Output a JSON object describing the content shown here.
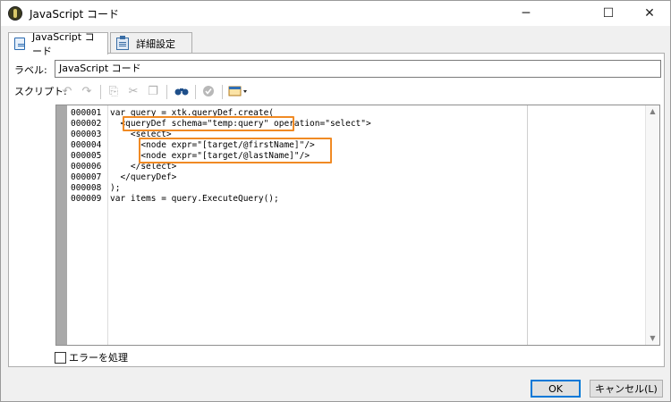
{
  "window": {
    "title": "JavaScript コード",
    "icon": "app-logo-icon"
  },
  "tabs": [
    {
      "label": "JavaScript コード",
      "icon": "script-doc-icon",
      "active": true
    },
    {
      "label": "詳細設定",
      "icon": "clipboard-icon",
      "active": false
    }
  ],
  "form": {
    "label_caption": "ラベル:",
    "label_value": "JavaScript コード",
    "script_caption": "スクリプト:"
  },
  "toolbar": [
    {
      "icon": "undo-icon",
      "enabled": false
    },
    {
      "icon": "redo-icon",
      "enabled": false
    },
    {
      "icon": "copy-icon",
      "enabled": false
    },
    {
      "icon": "cut-icon",
      "enabled": false
    },
    {
      "icon": "paste-icon",
      "enabled": false
    },
    {
      "icon": "find-binoculars-icon",
      "enabled": true
    },
    {
      "icon": "check-syntax-icon",
      "enabled": false
    },
    {
      "icon": "insert-dropdown-icon",
      "enabled": true
    }
  ],
  "code": {
    "line_numbers": [
      "000001",
      "000002",
      "000003",
      "000004",
      "000005",
      "000006",
      "000007",
      "000008",
      "000009"
    ],
    "lines": [
      "var query = xtk.queryDef.create(",
      "  <queryDef schema=\"temp:query\" operation=\"select\">",
      "    <select>",
      "      <node expr=\"[target/@firstName]\"/>",
      "      <node expr=\"[target/@lastName]\"/>",
      "    </select>",
      "  </queryDef>",
      ");",
      "var items = query.ExecuteQuery();"
    ]
  },
  "options": {
    "handle_errors_label": "エラーを処理",
    "handle_errors_checked": false
  },
  "buttons": {
    "ok": "OK",
    "cancel": "キャンセル(L)"
  },
  "colors": {
    "highlight": "#f08a24",
    "string": "#2a3fb8",
    "keyword": "#1a1aa6"
  }
}
